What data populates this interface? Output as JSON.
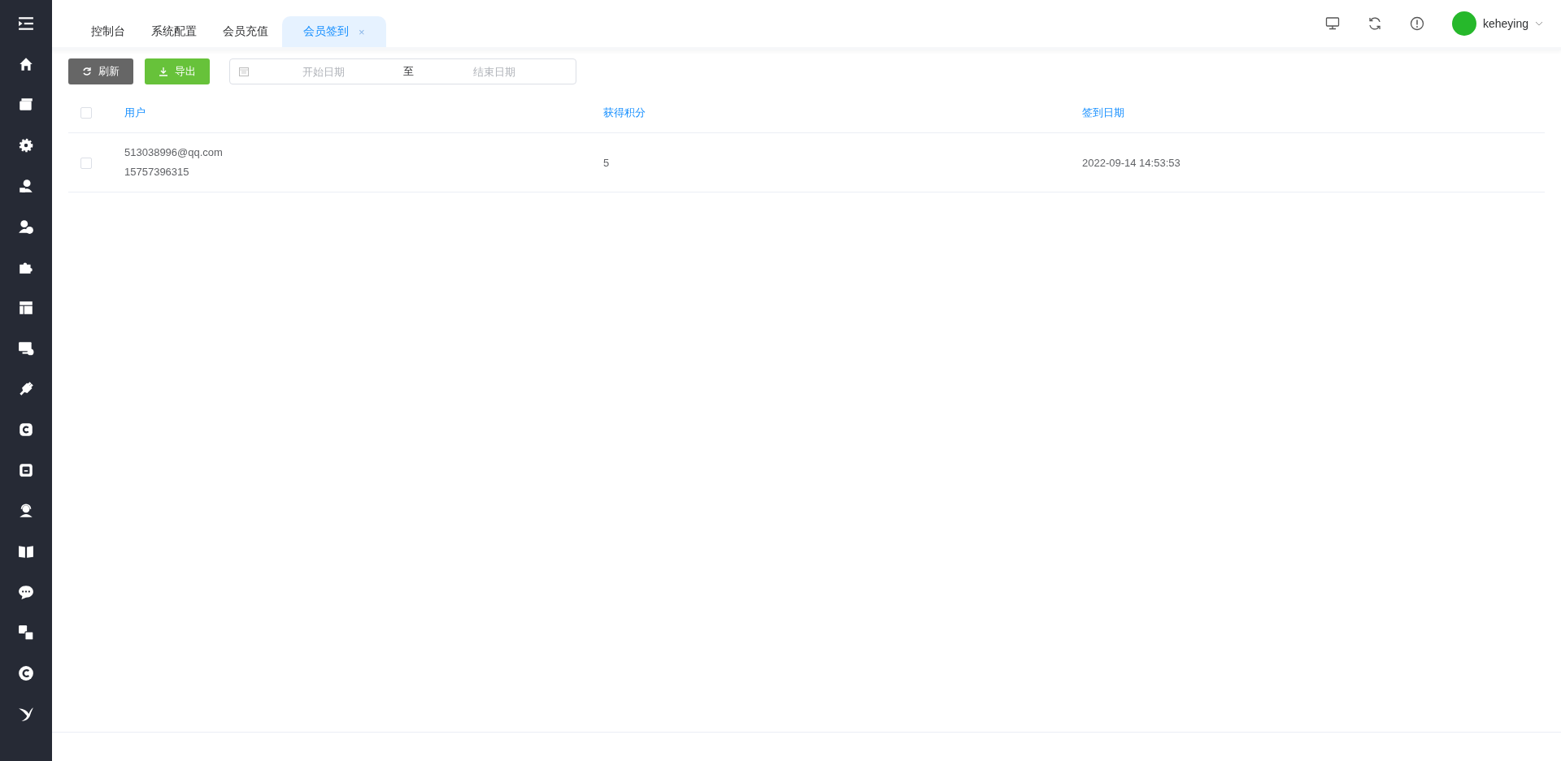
{
  "tabs": [
    {
      "label": "控制台",
      "selected": false
    },
    {
      "label": "系统配置",
      "selected": false
    },
    {
      "label": "会员充值",
      "selected": false
    },
    {
      "label": "会员签到",
      "selected": true,
      "close": "×"
    }
  ],
  "user": {
    "name": "keheying"
  },
  "toolbar": {
    "buttons": [
      {
        "label": "刷新",
        "kind": "refresh"
      },
      {
        "label": "导出",
        "kind": "export"
      }
    ],
    "date_range": {
      "start_placeholder": "开始日期",
      "separator": "至",
      "end_placeholder": "结束日期"
    }
  },
  "table": {
    "all_checked": false,
    "columns": [
      "用户",
      "获得积分",
      "签到日期"
    ],
    "rows": [
      {
        "checked": false,
        "email": "513038996@qq.com",
        "phone": "15757396315",
        "points": "5",
        "date": "2022-09-14 14:53:53"
      }
    ]
  }
}
